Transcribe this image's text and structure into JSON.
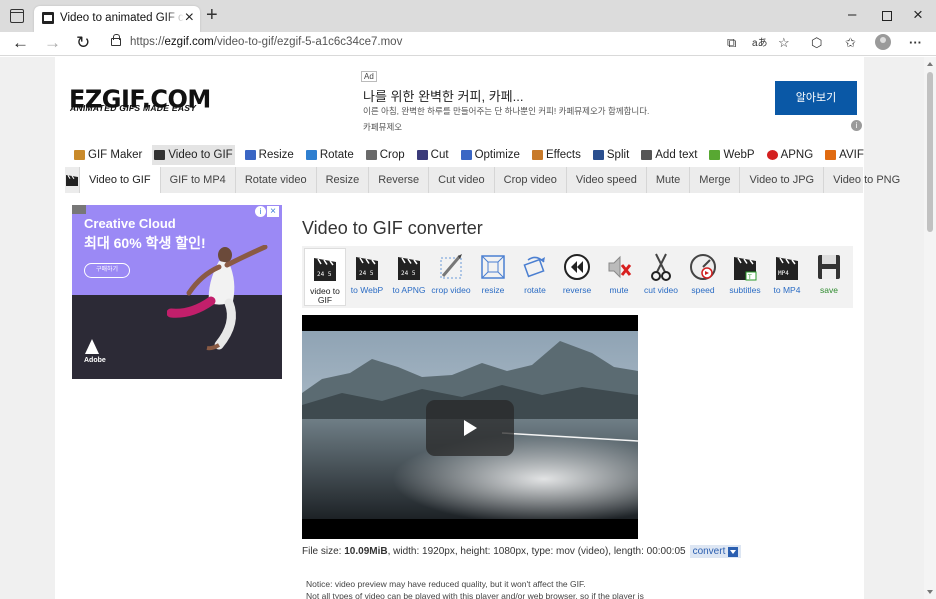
{
  "browser": {
    "tab_title": "Video to animated GIF converter",
    "url_prefix": "https://",
    "url_host": "ezgif.com",
    "url_path": "/video-to-gif/ezgif-5-a1c6c34ce7.mov",
    "read_aloud_label": "aあ"
  },
  "logo": {
    "name": "EZGIF.COM",
    "tagline": "ANIMATED GIFS MADE EASY"
  },
  "top_ad": {
    "label": "Ad",
    "headline": "나를 위한 완벽한 커피, 카페...",
    "description": "이른 아침, 완벽한 하루를 만들어주는 단 하나뿐인 커피! 카페뮤제오가 함께합니다.",
    "source": "카페뮤제오",
    "cta": "알아보기"
  },
  "main_nav": [
    {
      "label": "GIF Maker",
      "color": "#c98a2a"
    },
    {
      "label": "Video to GIF",
      "color": "#333333"
    },
    {
      "label": "Resize",
      "color": "#3a66c4"
    },
    {
      "label": "Rotate",
      "color": "#2f7fd0"
    },
    {
      "label": "Crop",
      "color": "#6a6a6a"
    },
    {
      "label": "Cut",
      "color": "#3a3a7a"
    },
    {
      "label": "Optimize",
      "color": "#3a66c4"
    },
    {
      "label": "Effects",
      "color": "#c87a2a"
    },
    {
      "label": "Split",
      "color": "#2a4f8f"
    },
    {
      "label": "Add text",
      "color": "#555555"
    },
    {
      "label": "WebP",
      "color": "#58a832"
    },
    {
      "label": "APNG",
      "color": "#d42020"
    },
    {
      "label": "AVIF",
      "color": "#e06a10"
    }
  ],
  "sub_nav": [
    "Video to GIF",
    "GIF to MP4",
    "Rotate video",
    "Resize",
    "Reverse",
    "Cut video",
    "Crop video",
    "Video speed",
    "Mute",
    "Merge",
    "Video to JPG",
    "Video to PNG"
  ],
  "side_ad": {
    "title": "Creative Cloud",
    "subtitle": "최대 60% 학생 할인!",
    "button": "구매하기",
    "brand": "Adobe"
  },
  "heading": "Video to GIF converter",
  "tools": [
    {
      "label": "video to GIF",
      "icon": "clapper-icon"
    },
    {
      "label": "to WebP",
      "icon": "clapper-icon"
    },
    {
      "label": "to APNG",
      "icon": "clapper-icon"
    },
    {
      "label": "crop video",
      "icon": "crop-icon"
    },
    {
      "label": "resize",
      "icon": "resize-icon"
    },
    {
      "label": "rotate",
      "icon": "rotate-icon"
    },
    {
      "label": "reverse",
      "icon": "reverse-icon"
    },
    {
      "label": "mute",
      "icon": "mute-icon"
    },
    {
      "label": "cut video",
      "icon": "scissors-icon"
    },
    {
      "label": "speed",
      "icon": "speed-icon"
    },
    {
      "label": "subtitles",
      "icon": "subtitles-icon"
    },
    {
      "label": "to MP4",
      "icon": "clapper-icon"
    },
    {
      "label": "save",
      "icon": "save-icon"
    }
  ],
  "file_info": {
    "size_label": "File size: ",
    "size_value": "10.09MiB",
    "details": ", width: 1920px, height: 1080px, type: mov (video), length: 00:00:05",
    "convert": "convert"
  },
  "notice": [
    "Notice: video preview may have reduced quality, but it won't affect the GIF.",
    "Not all types of video can be played with this player and/or web browser, so if the player is"
  ]
}
